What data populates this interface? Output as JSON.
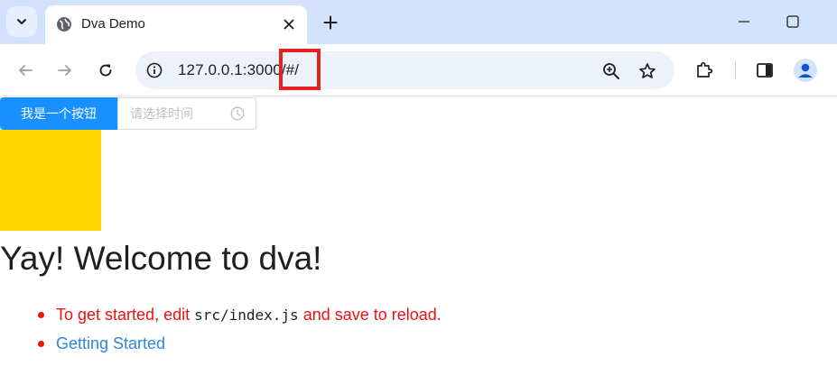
{
  "browser": {
    "tab": {
      "title": "Dva Demo",
      "favicon": "globe-icon"
    },
    "address": {
      "url_host": "127.0.0.1:300",
      "url_highlighted": "0/#/"
    },
    "icons": {
      "tab_search": "chevron-down-icon",
      "close": "close-icon",
      "new_tab": "plus-icon",
      "minimize": "minimize-icon",
      "maximize": "maximize-icon",
      "back": "arrow-left-icon",
      "forward": "arrow-right-icon",
      "reload": "reload-icon",
      "info": "info-icon",
      "zoom": "zoom-in-icon",
      "bookmark": "star-icon",
      "extensions": "puzzle-icon",
      "side_panel": "side-panel-icon",
      "profile": "avatar-icon"
    }
  },
  "page": {
    "button_label": "我是一个按钮",
    "time_picker_placeholder": "请选择时间",
    "heading": "Yay! Welcome to dva!",
    "list": {
      "item1_prefix": "To get started, edit ",
      "item1_code": "src/index.js",
      "item1_suffix": " and save to reload.",
      "item2_link": "Getting Started"
    }
  },
  "colors": {
    "primary_button": "#1890ff",
    "yellow_box": "#ffd700",
    "highlight": "#e52222",
    "red_text": "#ee1111",
    "link": "#2e86de"
  }
}
